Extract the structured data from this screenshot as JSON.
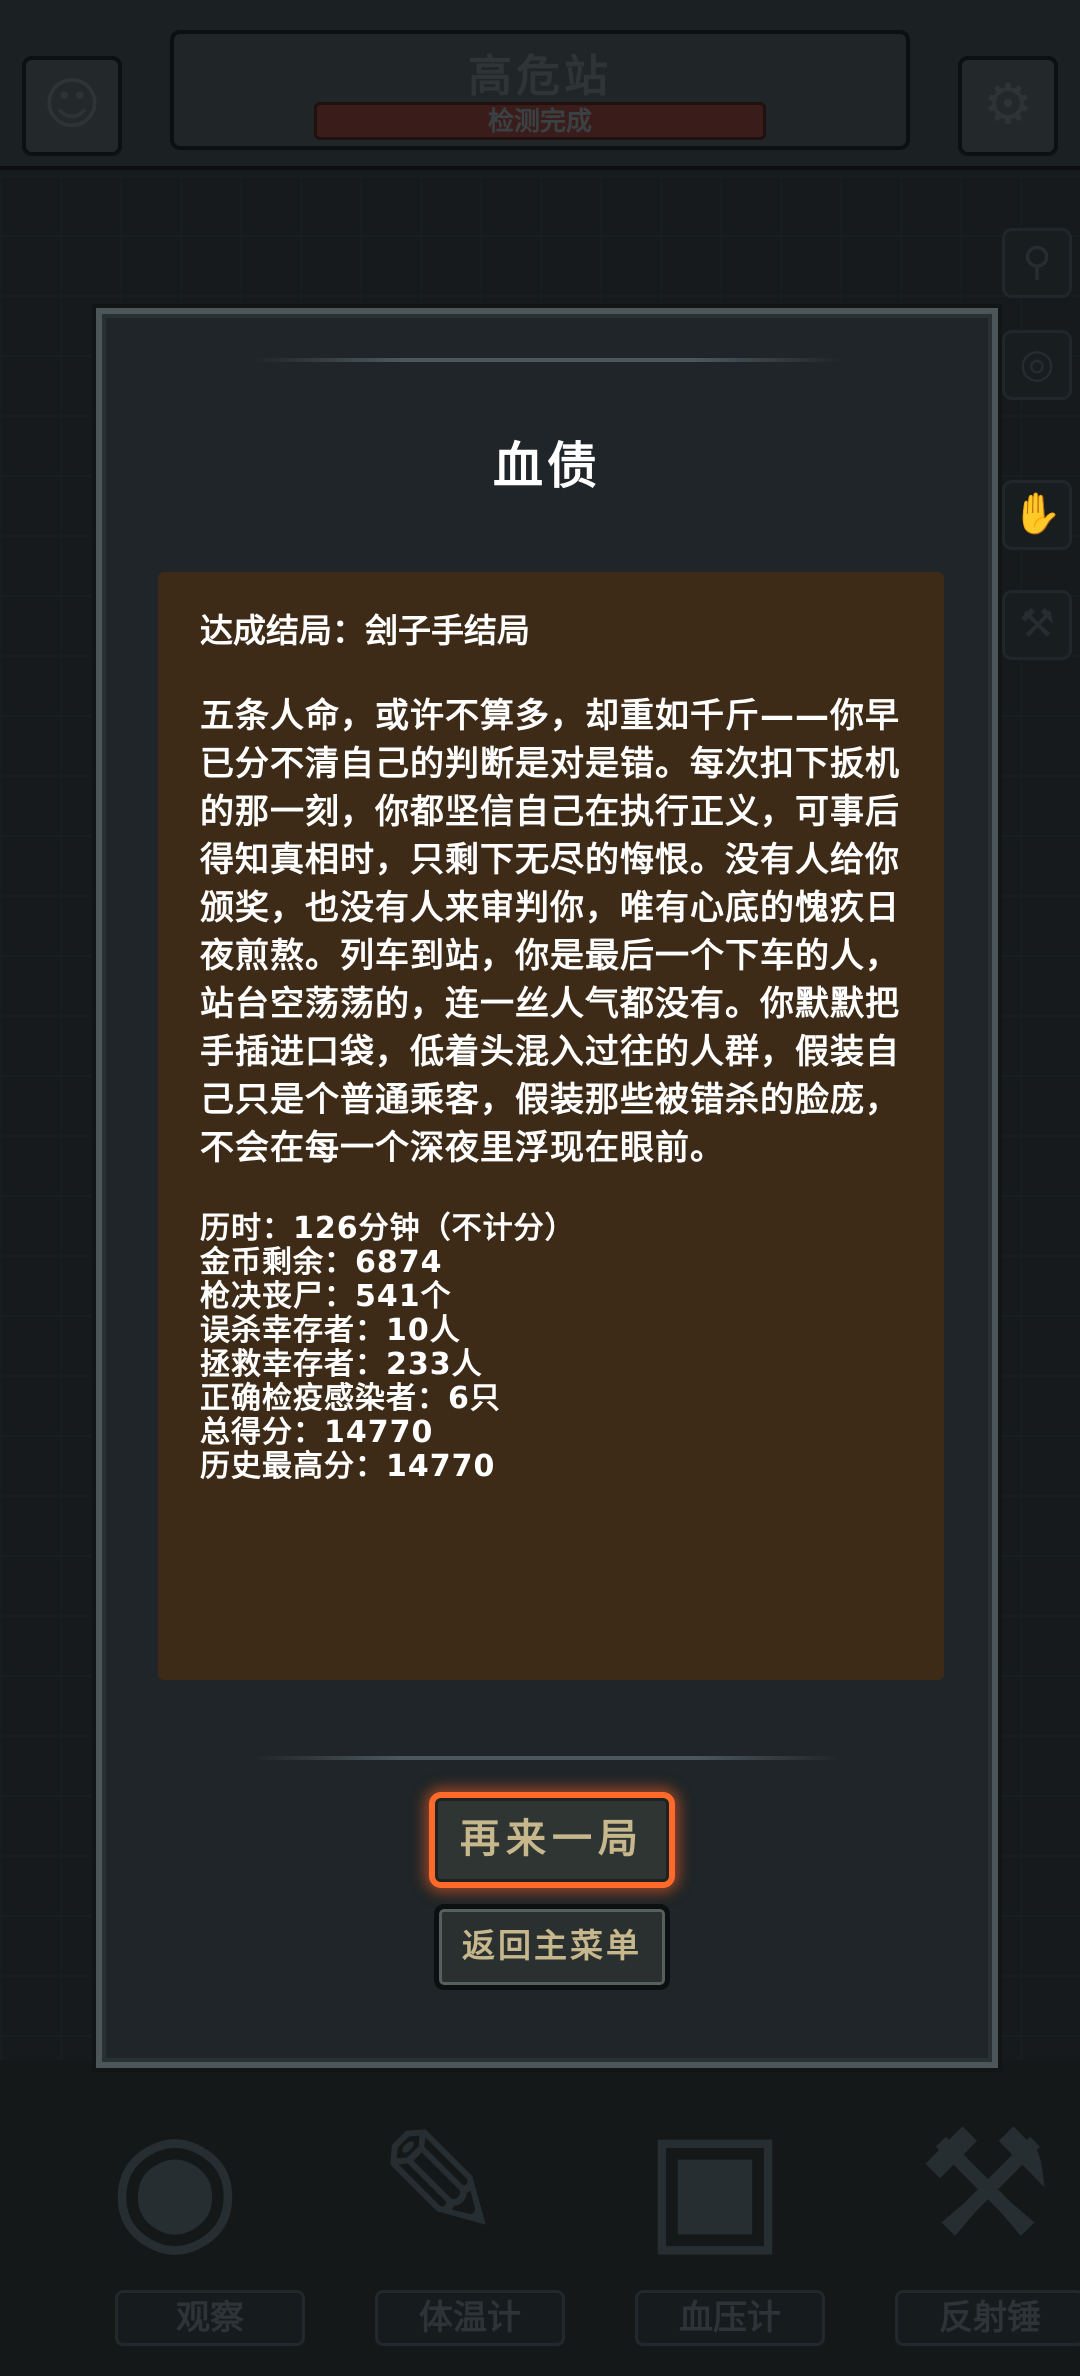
{
  "background": {
    "station_title": "高危站",
    "status": "检测完成",
    "tools": [
      {
        "label": "观察"
      },
      {
        "label": "体温计"
      },
      {
        "label": "血压计"
      },
      {
        "label": "反射锤"
      }
    ]
  },
  "modal": {
    "title": "血债",
    "ending": "达成结局：刽子手结局",
    "story": "五条人命，或许不算多，却重如千斤——你早已分不清自己的判断是对是错。每次扣下扳机的那一刻，你都坚信自己在执行正义，可事后得知真相时，只剩下无尽的悔恨。没有人给你颁奖，也没有人来审判你，唯有心底的愧疚日夜煎熬。列车到站，你是最后一个下车的人，站台空荡荡的，连一丝人气都没有。你默默把手插进口袋，低着头混入过往的人群，假装自己只是个普通乘客，假装那些被错杀的脸庞，不会在每一个深夜里浮现在眼前。",
    "stats": [
      "历时：126分钟（不计分）",
      "金币剩余：6874",
      "枪决丧尸：541个",
      "误杀幸存者：10人",
      "拯救幸存者：233人",
      "正确检疫感染者：6只",
      "总得分：14770",
      "历史最高分：14770"
    ],
    "retry_label": "再来一局",
    "menu_label": "返回主菜单"
  },
  "colors": {
    "modal_bg": "#1f2528",
    "panel_bg": "#3e2b17",
    "retry_border": "#ff6a2a",
    "button_text": "#c7b78c"
  }
}
